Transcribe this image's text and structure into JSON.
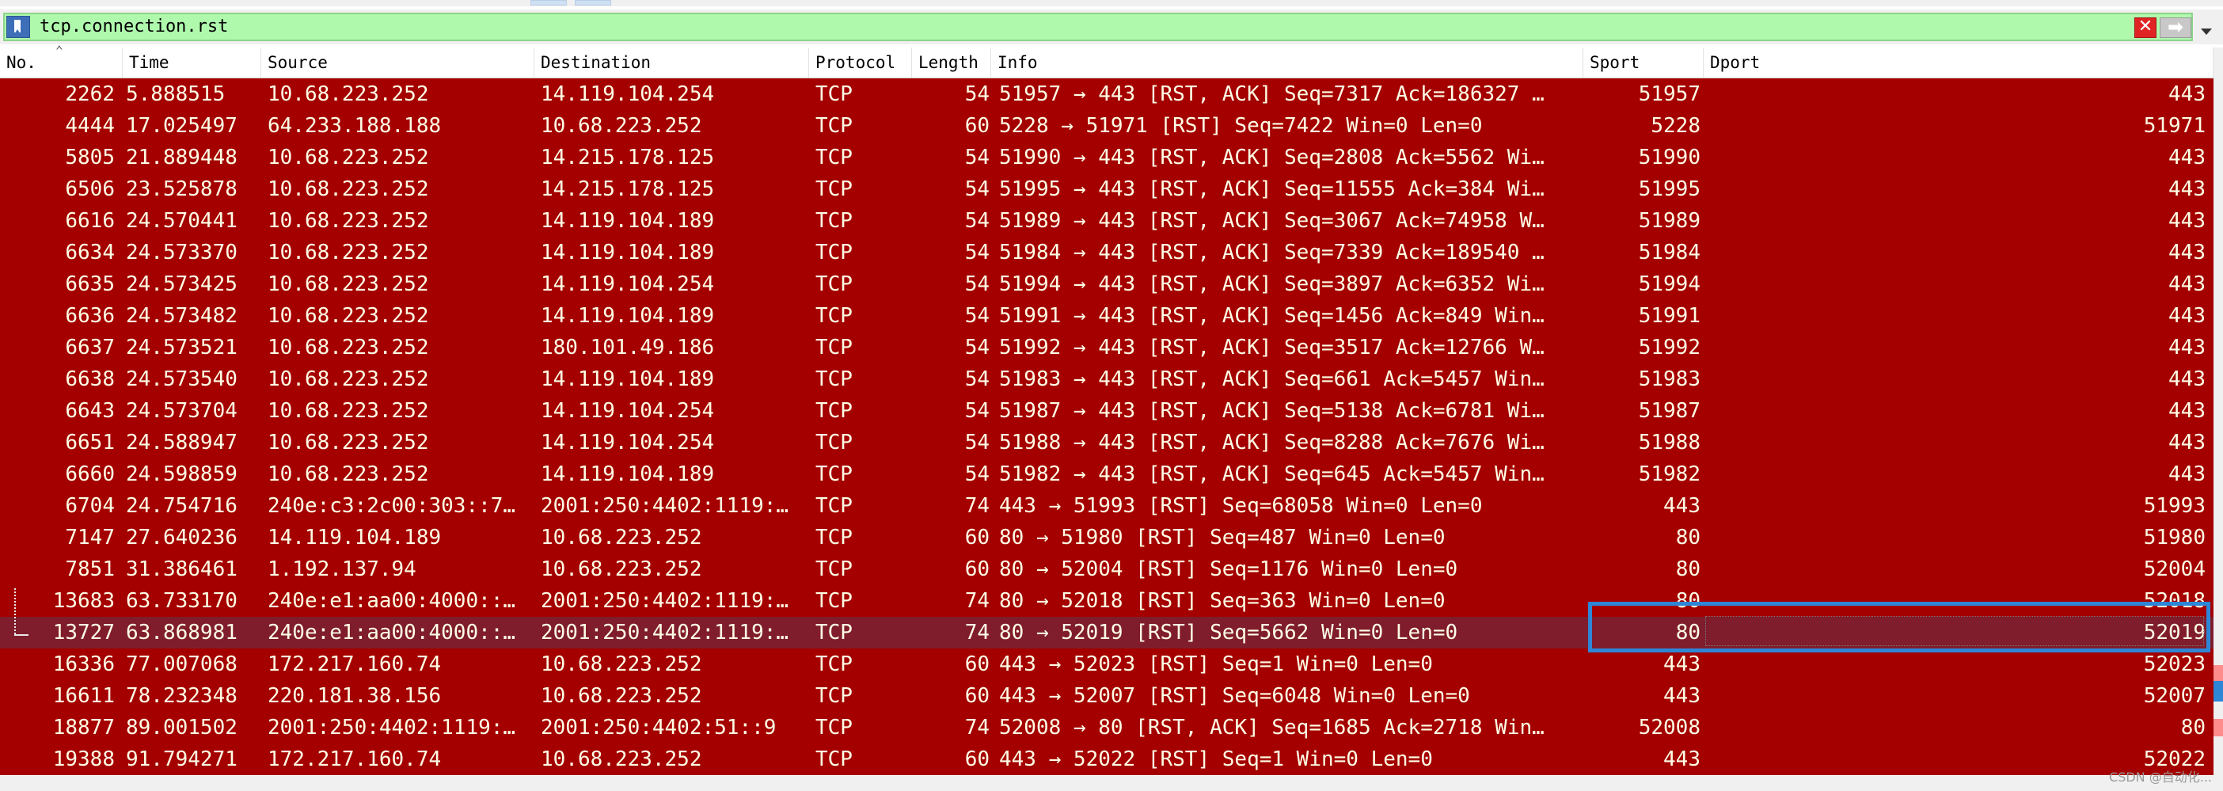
{
  "filter": {
    "value": "tcp.connection.rst",
    "clear_icon": "✕",
    "apply_icon": "➡"
  },
  "columns": [
    "No.",
    "Time",
    "Source",
    "Destination",
    "Protocol",
    "Length",
    "Info",
    "Sport",
    "Dport"
  ],
  "colors": {
    "row_background": "#a40000",
    "row_text": "#ffffe6",
    "selected_row": "#7f1d2d",
    "filter_valid": "#aff9ad",
    "highlight": "#2e86d6"
  },
  "packets": [
    {
      "no": "2262",
      "time": "5.888515",
      "source": "10.68.223.252",
      "destination": "14.119.104.254",
      "protocol": "TCP",
      "length": "54",
      "info": "51957 → 443 [RST, ACK] Seq=7317 Ack=186327 …",
      "sport": "51957",
      "dport": "443"
    },
    {
      "no": "4444",
      "time": "17.025497",
      "source": "64.233.188.188",
      "destination": "10.68.223.252",
      "protocol": "TCP",
      "length": "60",
      "info": "5228 → 51971 [RST] Seq=7422 Win=0 Len=0",
      "sport": "5228",
      "dport": "51971"
    },
    {
      "no": "5805",
      "time": "21.889448",
      "source": "10.68.223.252",
      "destination": "14.215.178.125",
      "protocol": "TCP",
      "length": "54",
      "info": "51990 → 443 [RST, ACK] Seq=2808 Ack=5562 Wi…",
      "sport": "51990",
      "dport": "443"
    },
    {
      "no": "6506",
      "time": "23.525878",
      "source": "10.68.223.252",
      "destination": "14.215.178.125",
      "protocol": "TCP",
      "length": "54",
      "info": "51995 → 443 [RST, ACK] Seq=11555 Ack=384 Wi…",
      "sport": "51995",
      "dport": "443"
    },
    {
      "no": "6616",
      "time": "24.570441",
      "source": "10.68.223.252",
      "destination": "14.119.104.189",
      "protocol": "TCP",
      "length": "54",
      "info": "51989 → 443 [RST, ACK] Seq=3067 Ack=74958 W…",
      "sport": "51989",
      "dport": "443"
    },
    {
      "no": "6634",
      "time": "24.573370",
      "source": "10.68.223.252",
      "destination": "14.119.104.189",
      "protocol": "TCP",
      "length": "54",
      "info": "51984 → 443 [RST, ACK] Seq=7339 Ack=189540 …",
      "sport": "51984",
      "dport": "443"
    },
    {
      "no": "6635",
      "time": "24.573425",
      "source": "10.68.223.252",
      "destination": "14.119.104.254",
      "protocol": "TCP",
      "length": "54",
      "info": "51994 → 443 [RST, ACK] Seq=3897 Ack=6352 Wi…",
      "sport": "51994",
      "dport": "443"
    },
    {
      "no": "6636",
      "time": "24.573482",
      "source": "10.68.223.252",
      "destination": "14.119.104.189",
      "protocol": "TCP",
      "length": "54",
      "info": "51991 → 443 [RST, ACK] Seq=1456 Ack=849 Win…",
      "sport": "51991",
      "dport": "443"
    },
    {
      "no": "6637",
      "time": "24.573521",
      "source": "10.68.223.252",
      "destination": "180.101.49.186",
      "protocol": "TCP",
      "length": "54",
      "info": "51992 → 443 [RST, ACK] Seq=3517 Ack=12766 W…",
      "sport": "51992",
      "dport": "443"
    },
    {
      "no": "6638",
      "time": "24.573540",
      "source": "10.68.223.252",
      "destination": "14.119.104.189",
      "protocol": "TCP",
      "length": "54",
      "info": "51983 → 443 [RST, ACK] Seq=661 Ack=5457 Win…",
      "sport": "51983",
      "dport": "443"
    },
    {
      "no": "6643",
      "time": "24.573704",
      "source": "10.68.223.252",
      "destination": "14.119.104.254",
      "protocol": "TCP",
      "length": "54",
      "info": "51987 → 443 [RST, ACK] Seq=5138 Ack=6781 Wi…",
      "sport": "51987",
      "dport": "443"
    },
    {
      "no": "6651",
      "time": "24.588947",
      "source": "10.68.223.252",
      "destination": "14.119.104.254",
      "protocol": "TCP",
      "length": "54",
      "info": "51988 → 443 [RST, ACK] Seq=8288 Ack=7676 Wi…",
      "sport": "51988",
      "dport": "443"
    },
    {
      "no": "6660",
      "time": "24.598859",
      "source": "10.68.223.252",
      "destination": "14.119.104.189",
      "protocol": "TCP",
      "length": "54",
      "info": "51982 → 443 [RST, ACK] Seq=645 Ack=5457 Win…",
      "sport": "51982",
      "dport": "443"
    },
    {
      "no": "6704",
      "time": "24.754716",
      "source": "240e:c3:2c00:303::7…",
      "destination": "2001:250:4402:1119:…",
      "protocol": "TCP",
      "length": "74",
      "info": "443 → 51993 [RST] Seq=68058 Win=0 Len=0",
      "sport": "443",
      "dport": "51993"
    },
    {
      "no": "7147",
      "time": "27.640236",
      "source": "14.119.104.189",
      "destination": "10.68.223.252",
      "protocol": "TCP",
      "length": "60",
      "info": "80 → 51980 [RST] Seq=487 Win=0 Len=0",
      "sport": "80",
      "dport": "51980"
    },
    {
      "no": "7851",
      "time": "31.386461",
      "source": "1.192.137.94",
      "destination": "10.68.223.252",
      "protocol": "TCP",
      "length": "60",
      "info": "80 → 52004 [RST] Seq=1176 Win=0 Len=0",
      "sport": "80",
      "dport": "52004"
    },
    {
      "no": "13683",
      "time": "63.733170",
      "source": "240e:e1:aa00:4000::…",
      "destination": "2001:250:4402:1119:…",
      "protocol": "TCP",
      "length": "74",
      "info": "80 → 52018 [RST] Seq=363 Win=0 Len=0",
      "sport": "80",
      "dport": "52018"
    },
    {
      "no": "13727",
      "time": "63.868981",
      "source": "240e:e1:aa00:4000::…",
      "destination": "2001:250:4402:1119:…",
      "protocol": "TCP",
      "length": "74",
      "info": "80 → 52019 [RST] Seq=5662 Win=0 Len=0",
      "sport": "80",
      "dport": "52019",
      "selected": true
    },
    {
      "no": "16336",
      "time": "77.007068",
      "source": "172.217.160.74",
      "destination": "10.68.223.252",
      "protocol": "TCP",
      "length": "60",
      "info": "443 → 52023 [RST] Seq=1 Win=0 Len=0",
      "sport": "443",
      "dport": "52023"
    },
    {
      "no": "16611",
      "time": "78.232348",
      "source": "220.181.38.156",
      "destination": "10.68.223.252",
      "protocol": "TCP",
      "length": "60",
      "info": "443 → 52007 [RST] Seq=6048 Win=0 Len=0",
      "sport": "443",
      "dport": "52007"
    },
    {
      "no": "18877",
      "time": "89.001502",
      "source": "2001:250:4402:1119:…",
      "destination": "2001:250:4402:51::9",
      "protocol": "TCP",
      "length": "74",
      "info": "52008 → 80 [RST, ACK] Seq=1685 Ack=2718 Win…",
      "sport": "52008",
      "dport": "80"
    },
    {
      "no": "19388",
      "time": "91.794271",
      "source": "172.217.160.74",
      "destination": "10.68.223.252",
      "protocol": "TCP",
      "length": "60",
      "info": "443 → 52022 [RST] Seq=1 Win=0 Len=0",
      "sport": "443",
      "dport": "52022"
    }
  ],
  "watermark": "CSDN @自动化..."
}
